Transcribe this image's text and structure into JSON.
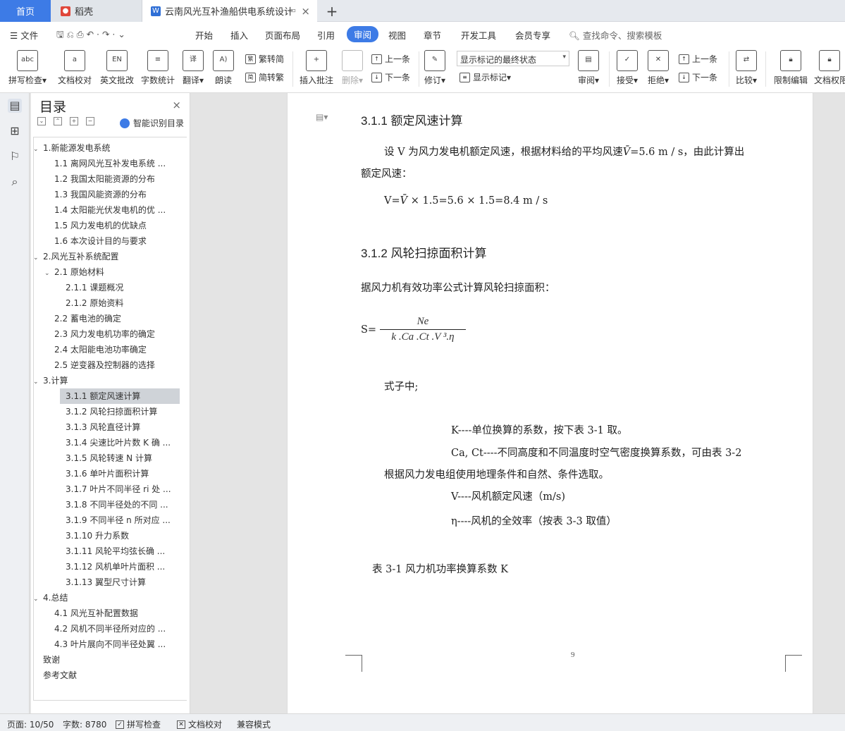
{
  "tabs": {
    "home": "首页",
    "doc1": "稻壳",
    "doc2": "云南风光互补渔船供电系统设计"
  },
  "menu": {
    "file": "文件",
    "items": [
      "开始",
      "插入",
      "页面布局",
      "引用",
      "审阅",
      "视图",
      "章节",
      "开发工具",
      "会员专享"
    ],
    "active": "审阅",
    "search": "查找命令、搜索模板"
  },
  "ribbon": {
    "spell": "拼写检查",
    "doccheck": "文档校对",
    "engrev": "英文批改",
    "wordcount": "字数统计",
    "translate": "翻译",
    "read": "朗读",
    "toTrad": "繁转简",
    "toSimp": "简转繁",
    "insertComment": "插入批注",
    "delete": "删除",
    "prev": "上一条",
    "next": "下一条",
    "revise": "修订",
    "markupState": "显示标记的最终状态",
    "showMarkup": "显示标记",
    "review": "审阅",
    "accept": "接受",
    "reject": "拒绝",
    "prev2": "上一条",
    "next2": "下一条",
    "compare": "比较",
    "restrict": "限制编辑",
    "docperm": "文档权限"
  },
  "toc": {
    "title": "目录",
    "smart": "智能识别目录",
    "items": [
      {
        "label": "1.新能源发电系统",
        "level": 1,
        "arrow": "⌄"
      },
      {
        "label": "1.1 离网风光互补发电系统 ...",
        "level": 2
      },
      {
        "label": "1.2 我国太阳能资源的分布",
        "level": 2
      },
      {
        "label": "1.3 我国风能资源的分布",
        "level": 2
      },
      {
        "label": "1.4 太阳能光伏发电机的优 ...",
        "level": 2
      },
      {
        "label": "1.5 风力发电机的优缺点",
        "level": 2
      },
      {
        "label": "1.6 本次设计目的与要求",
        "level": 2
      },
      {
        "label": "2.风光互补系统配置",
        "level": 1,
        "arrow": "⌄"
      },
      {
        "label": "2.1 原始材料",
        "level": 2,
        "arrow": "⌄"
      },
      {
        "label": "2.1.1 课题概况",
        "level": 3
      },
      {
        "label": "2.1.2 原始资料",
        "level": 3
      },
      {
        "label": "2.2  蓄电池的确定",
        "level": 2
      },
      {
        "label": "2.3 风力发电机功率的确定",
        "level": 2
      },
      {
        "label": "2.4 太阳能电池功率确定",
        "level": 2
      },
      {
        "label": "2.5 逆变器及控制器的选择",
        "level": 2
      },
      {
        "label": "3.计算",
        "level": 1,
        "arrow": "⌄"
      },
      {
        "label": "3.1.1 额定风速计算",
        "level": 3,
        "active": true
      },
      {
        "label": "3.1.2 风轮扫掠面积计算",
        "level": 3
      },
      {
        "label": "3.1.3 风轮直径计算",
        "level": 3
      },
      {
        "label": "3.1.4 尖速比叶片数 K 确 ...",
        "level": 3
      },
      {
        "label": "3.1.5 风轮转速 N 计算",
        "level": 3
      },
      {
        "label": "3.1.6 单叶片面积计算",
        "level": 3
      },
      {
        "label": "3.1.7 叶片不同半径 ri 处 ...",
        "level": 3
      },
      {
        "label": "3.1.8 不同半径处的不同 ...",
        "level": 3
      },
      {
        "label": "3.1.9 不同半径 n 所对应 ...",
        "level": 3
      },
      {
        "label": "3.1.10 升力系数",
        "level": 3
      },
      {
        "label": "3.1.11 风轮平均弦长确 ...",
        "level": 3
      },
      {
        "label": "3.1.12 风机单叶片面积 ...",
        "level": 3
      },
      {
        "label": "3.1.13 翼型尺寸计算",
        "level": 3
      },
      {
        "label": "4.总结",
        "level": 1,
        "arrow": "⌄"
      },
      {
        "label": "4.1 风光互补配置数据",
        "level": 2
      },
      {
        "label": "4.2 风机不同半径所对应的 ...",
        "level": 2
      },
      {
        "label": "4.3 叶片展向不同半径处翼 ...",
        "level": 2
      },
      {
        "label": "致谢",
        "level": 1
      },
      {
        "label": "参考文献",
        "level": 1
      }
    ]
  },
  "doc": {
    "h1": "3.1.1 额定风速计算",
    "p1a": "设 V 为风力发电机额定风速，根据材料给的平均风速",
    "vbar": "V̄",
    "p1b": "=5.6 m / s，由此计算出",
    "p1c": "额定风速：",
    "eq1a": "V=",
    "eq1b": " × 1.5=5.6 × 1.5=8.4 m / s",
    "h2": "3.1.2 风轮扫掠面积计算",
    "p2": "据风力机有效功率公式计算风轮扫掠面积：",
    "s_eq": "S=",
    "num": "Ne",
    "den": "k .Ca .Ct .V ³.η",
    "where": "式子中;",
    "k": "K----单位换算的系数，按下表 3-1 取。",
    "ca": "Ca,  Ct----不同高度和不同温度时空气密度换算系数，可由表 3-2",
    "ca2": "根据风力发电组使用地理条件和自然、条件选取。",
    "v": "V----风机额定风速（m/s)",
    "eta": "η----风机的全效率（按表 3-3 取值）",
    "table": "表 3-1 风力机功率换算系数 K",
    "pagenum": "9"
  },
  "status": {
    "page": "页面: 10/50",
    "words": "字数: 8780",
    "spell": "拼写检查",
    "doccheck": "文档校对",
    "compat": "兼容模式"
  }
}
